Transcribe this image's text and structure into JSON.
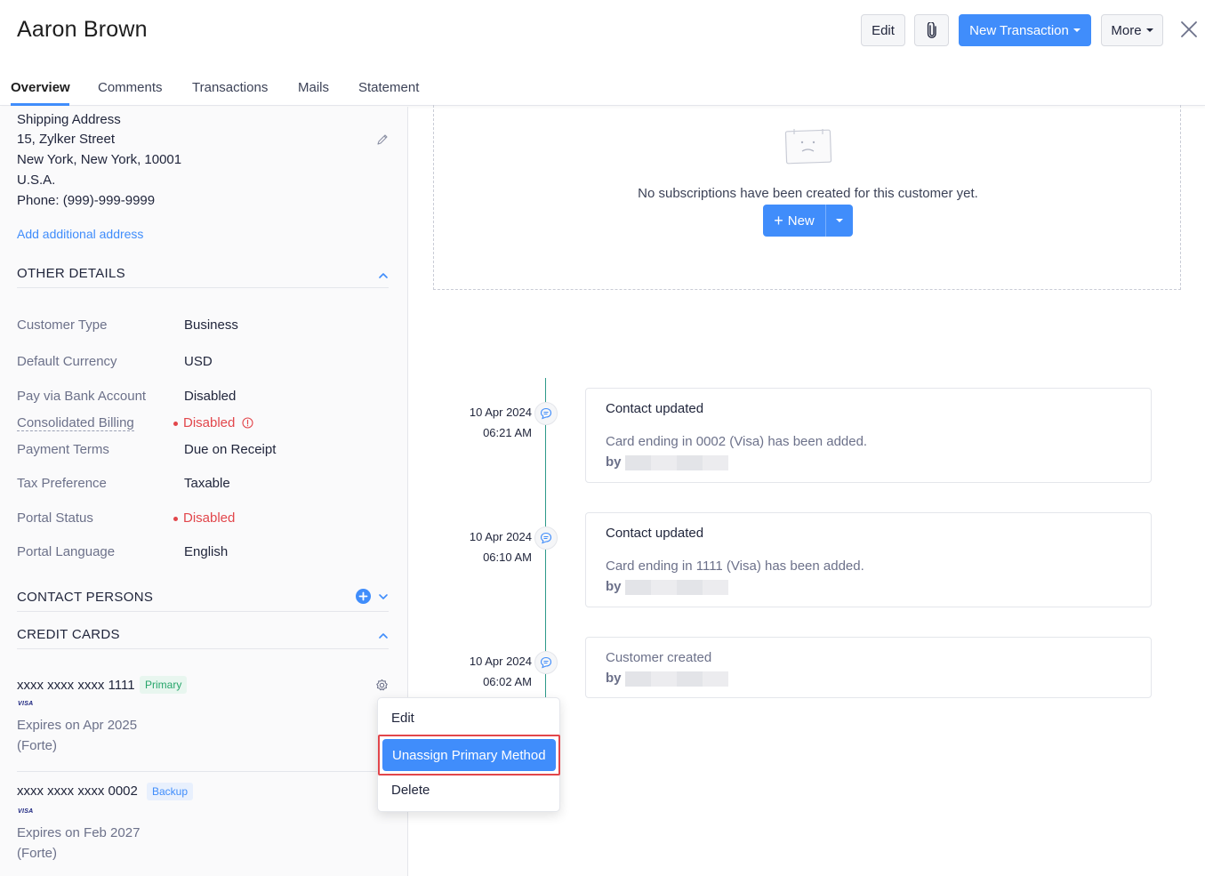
{
  "header": {
    "title": "Aaron Brown",
    "edit_label": "Edit",
    "new_transaction_label": "New Transaction",
    "more_label": "More"
  },
  "tabs": [
    {
      "label": "Overview",
      "active": true
    },
    {
      "label": "Comments"
    },
    {
      "label": "Transactions"
    },
    {
      "label": "Mails"
    },
    {
      "label": "Statement"
    }
  ],
  "shipping": {
    "heading": "Shipping Address",
    "line1": "15, Zylker Street",
    "line2": "New York, New York, 10001",
    "line3": "U.S.A.",
    "phone": "Phone: (999)-999-9999",
    "add_link": "Add additional address"
  },
  "other_details": {
    "title": "OTHER DETAILS",
    "rows": [
      {
        "label": "Customer Type",
        "value": "Business"
      },
      {
        "label": "Default Currency",
        "value": "USD"
      },
      {
        "label": "Pay via Bank Account",
        "value": "Disabled"
      },
      {
        "label": "Consolidated Billing",
        "value": "Disabled"
      },
      {
        "label": "Payment Terms",
        "value": "Due on Receipt"
      },
      {
        "label": "Tax Preference",
        "value": "Taxable"
      },
      {
        "label": "Portal Status",
        "value": "Disabled"
      },
      {
        "label": "Portal Language",
        "value": "English"
      }
    ]
  },
  "contact_persons": {
    "title": "CONTACT PERSONS"
  },
  "credit_cards": {
    "title": "CREDIT CARDS",
    "cards": [
      {
        "number": "xxxx xxxx xxxx 1111",
        "badge": "Primary",
        "brand": "VISA",
        "expires": "Expires on Apr 2025",
        "gateway": "(Forte)"
      },
      {
        "number": "xxxx xxxx xxxx 0002",
        "badge": "Backup",
        "brand": "VISA",
        "expires": "Expires on Feb 2027",
        "gateway": "(Forte)"
      }
    ]
  },
  "subscriptions": {
    "empty_message": "No subscriptions have been created for this customer yet.",
    "new_label": "New"
  },
  "timeline": [
    {
      "date": "10 Apr 2024",
      "time": "06:21 AM",
      "title": "Contact updated",
      "desc": "Card ending in 0002 (Visa) has been added.",
      "by": "by"
    },
    {
      "date": "10 Apr 2024",
      "time": "06:10 AM",
      "title": "Contact updated",
      "desc": "Card ending in 1111 (Visa) has been added.",
      "by": "by"
    },
    {
      "date": "10 Apr 2024",
      "time": "06:02 AM",
      "title": "Customer created",
      "desc": "",
      "by": "by"
    }
  ],
  "card_menu": {
    "edit": "Edit",
    "unassign": "Unassign Primary Method",
    "delete": "Delete"
  },
  "colors": {
    "accent": "#408dfb",
    "danger": "#e2464b",
    "success": "#26a56a",
    "timeline": "#2d9a8a"
  }
}
